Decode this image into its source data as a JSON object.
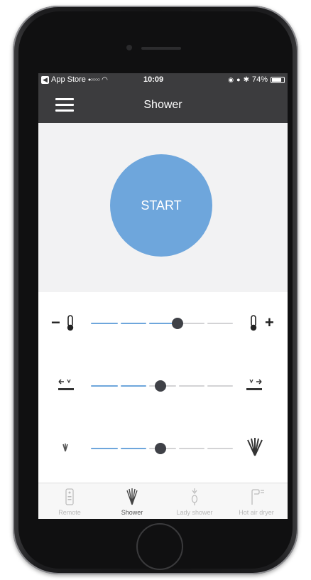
{
  "status_bar": {
    "carrier": "App Store",
    "time": "10:09",
    "battery": "74%"
  },
  "header": {
    "title": "Shower"
  },
  "main": {
    "start_label": "START"
  },
  "sliders": [
    {
      "name": "temperature",
      "value": 0.61
    },
    {
      "name": "spray-position",
      "value": 0.49
    },
    {
      "name": "water-pressure",
      "value": 0.49
    }
  ],
  "tabs": [
    {
      "label": "Remote",
      "icon": "remote-icon"
    },
    {
      "label": "Shower",
      "icon": "shower-icon",
      "active": true
    },
    {
      "label": "Lady shower",
      "icon": "lady-shower-icon"
    },
    {
      "label": "Hot air dryer",
      "icon": "hot-air-dryer-icon"
    }
  ],
  "colors": {
    "accent": "#6ea6dc",
    "bar": "#3c3c3e",
    "knob": "#3f4147"
  }
}
